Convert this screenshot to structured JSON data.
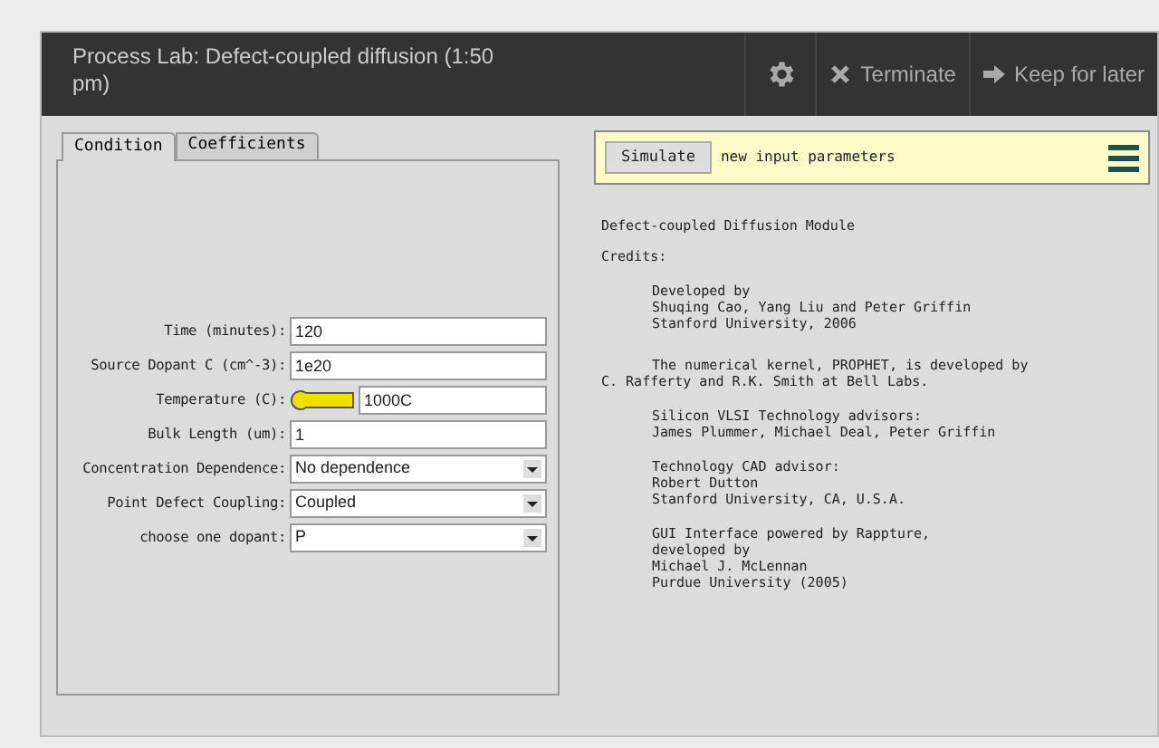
{
  "window": {
    "title": "Process Lab: Defect-coupled diffusion (1:50 pm)"
  },
  "toolbar": [
    {
      "kind": "gear"
    },
    {
      "kind": "close",
      "label": "Terminate"
    },
    {
      "kind": "arrow",
      "label": "Keep for later"
    }
  ],
  "tabs": [
    {
      "label": "Condition",
      "selected": true
    },
    {
      "label": "Coefficients",
      "selected": false
    }
  ],
  "form": [
    {
      "kind": "text",
      "label": "Time (minutes):",
      "value": "120"
    },
    {
      "kind": "text",
      "label": "Source Dopant C (cm^-3):",
      "value": "1e20"
    },
    {
      "kind": "thermometer",
      "label": "Temperature (C):",
      "value": "1000C"
    },
    {
      "kind": "text",
      "label": "Bulk Length (um):",
      "value": "1"
    },
    {
      "kind": "select",
      "label": "Concentration Dependence:",
      "value": "No dependence"
    },
    {
      "kind": "select",
      "label": "Point Defect Coupling:",
      "value": "Coupled"
    },
    {
      "kind": "select",
      "label": "choose one dopant:",
      "value": "P"
    }
  ],
  "simulate": {
    "button": "Simulate",
    "message": "new input parameters"
  },
  "credits": [
    {
      "kind": "plain",
      "text": "Defect-coupled Diffusion Module"
    },
    {
      "kind": "plain",
      "text": "Credits:"
    },
    {
      "kind": "indented",
      "text": "Developed by\nShuqing Cao, Yang Liu and Peter Griffin\nStanford University, 2006"
    },
    {
      "kind": "first-line-indent",
      "text": "The numerical kernel, PROPHET, is developed by\nC. Rafferty and R.K. Smith at Bell Labs."
    },
    {
      "kind": "indented",
      "text": "Silicon VLSI Technology advisors:\nJames Plummer, Michael Deal, Peter Griffin"
    },
    {
      "kind": "indented",
      "text": "Technology CAD advisor:\nRobert Dutton\nStanford University, CA, U.S.A."
    },
    {
      "kind": "indented",
      "text": "GUI Interface powered by Rappture,\ndeveloped by\nMichael J. McLennan\nPurdue University (2005)"
    }
  ]
}
